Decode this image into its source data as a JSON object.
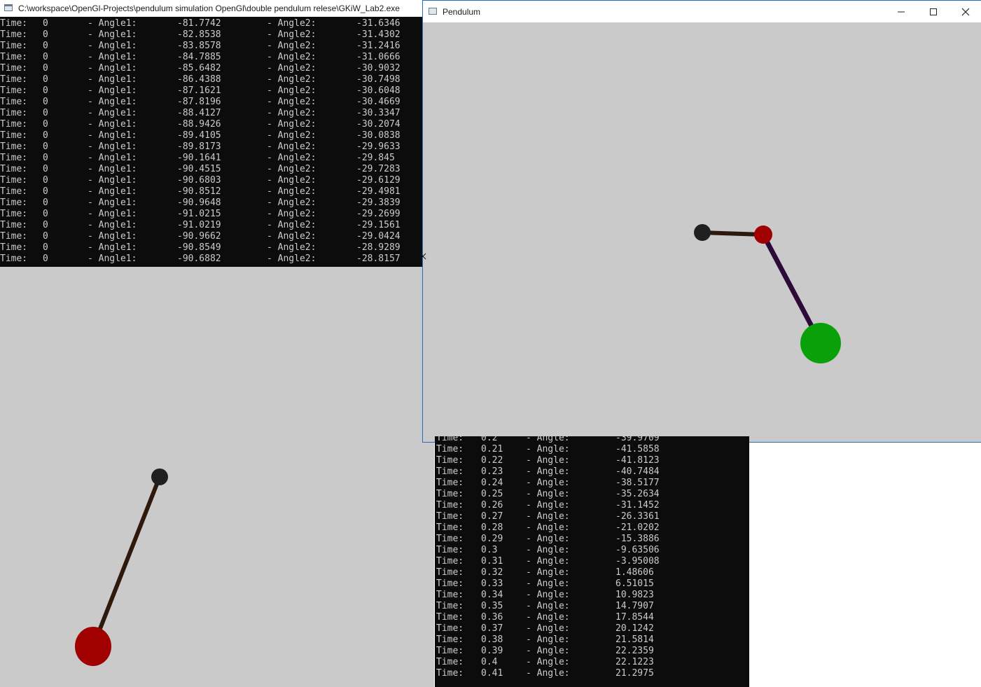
{
  "console_top": {
    "title": "C:\\workspace\\OpenGl-Projects\\pendulum simulation OpenGl\\double pendulum relese\\GKiW_Lab2.exe",
    "rows": [
      {
        "time": "0",
        "a1": "-81.7742",
        "a2": "-31.6346"
      },
      {
        "time": "0",
        "a1": "-82.8538",
        "a2": "-31.4302"
      },
      {
        "time": "0",
        "a1": "-83.8578",
        "a2": "-31.2416"
      },
      {
        "time": "0",
        "a1": "-84.7885",
        "a2": "-31.0666"
      },
      {
        "time": "0",
        "a1": "-85.6482",
        "a2": "-30.9032"
      },
      {
        "time": "0",
        "a1": "-86.4388",
        "a2": "-30.7498"
      },
      {
        "time": "0",
        "a1": "-87.1621",
        "a2": "-30.6048"
      },
      {
        "time": "0",
        "a1": "-87.8196",
        "a2": "-30.4669"
      },
      {
        "time": "0",
        "a1": "-88.4127",
        "a2": "-30.3347"
      },
      {
        "time": "0",
        "a1": "-88.9426",
        "a2": "-30.2074"
      },
      {
        "time": "0",
        "a1": "-89.4105",
        "a2": "-30.0838"
      },
      {
        "time": "0",
        "a1": "-89.8173",
        "a2": "-29.9633"
      },
      {
        "time": "0",
        "a1": "-90.1641",
        "a2": "-29.845"
      },
      {
        "time": "0",
        "a1": "-90.4515",
        "a2": "-29.7283"
      },
      {
        "time": "0",
        "a1": "-90.6803",
        "a2": "-29.6129"
      },
      {
        "time": "0",
        "a1": "-90.8512",
        "a2": "-29.4981"
      },
      {
        "time": "0",
        "a1": "-90.9648",
        "a2": "-29.3839"
      },
      {
        "time": "0",
        "a1": "-91.0215",
        "a2": "-29.2699"
      },
      {
        "time": "0",
        "a1": "-91.0219",
        "a2": "-29.1561"
      },
      {
        "time": "0",
        "a1": "-90.9662",
        "a2": "-29.0424"
      },
      {
        "time": "0",
        "a1": "-90.8549",
        "a2": "-28.9289"
      },
      {
        "time": "0",
        "a1": "-90.6882",
        "a2": "-28.8157"
      }
    ],
    "labels": {
      "time": "Time:",
      "angle1": "- Angle1:",
      "angle2": "- Angle2:"
    }
  },
  "pendulum_window": {
    "title": "Pendulum",
    "icons": {
      "minimize": "minimize-icon",
      "maximize": "maximize-icon",
      "close": "close-icon"
    }
  },
  "console_bottom": {
    "labels": {
      "time": "Time:",
      "angle": "- Angle:"
    },
    "rows": [
      {
        "time": "0.2",
        "angle": "-39.9709"
      },
      {
        "time": "0.21",
        "angle": "-41.5858"
      },
      {
        "time": "0.22",
        "angle": "-41.8123"
      },
      {
        "time": "0.23",
        "angle": "-40.7484"
      },
      {
        "time": "0.24",
        "angle": "-38.5177"
      },
      {
        "time": "0.25",
        "angle": "-35.2634"
      },
      {
        "time": "0.26",
        "angle": "-31.1452"
      },
      {
        "time": "0.27",
        "angle": "-26.3361"
      },
      {
        "time": "0.28",
        "angle": "-21.0202"
      },
      {
        "time": "0.29",
        "angle": "-15.3886"
      },
      {
        "time": "0.3",
        "angle": "-9.63506"
      },
      {
        "time": "0.31",
        "angle": "-3.95008"
      },
      {
        "time": "0.32",
        "angle": "1.48606"
      },
      {
        "time": "0.33",
        "angle": "6.51015"
      },
      {
        "time": "0.34",
        "angle": "10.9823"
      },
      {
        "time": "0.35",
        "angle": "14.7907"
      },
      {
        "time": "0.36",
        "angle": "17.8544"
      },
      {
        "time": "0.37",
        "angle": "20.1242"
      },
      {
        "time": "0.38",
        "angle": "21.5814"
      },
      {
        "time": "0.39",
        "angle": "22.2359"
      },
      {
        "time": "0.4",
        "angle": "22.1223"
      },
      {
        "time": "0.41",
        "angle": "21.2975"
      }
    ]
  },
  "colors": {
    "canvas_bg": "#cacaca",
    "console_bg": "#0c0c0c",
    "console_text": "#cccccc",
    "rod_dark_brown": "#2e1a0c",
    "rod_purple": "#2d0a3a",
    "pivot_black": "#202020",
    "bob_red": "#a00000",
    "bob_green": "#0aa00a"
  }
}
